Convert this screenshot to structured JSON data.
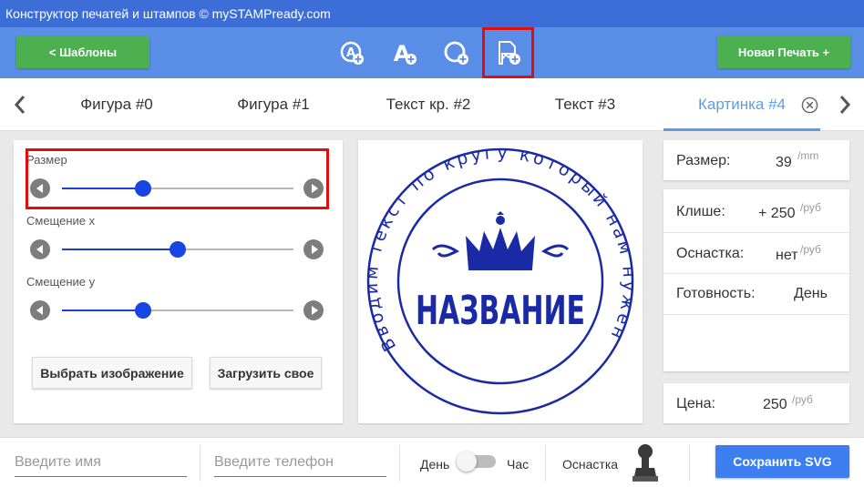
{
  "window": {
    "title": "Конструктор печатей и штампов © mySTAMPready.com"
  },
  "toolbar": {
    "templates_label": "<  Шаблоны",
    "new_stamp_label": "Новая Печать +",
    "tools": [
      "add-circle-text-icon",
      "add-text-icon",
      "add-shape-icon",
      "add-image-icon"
    ],
    "highlighted_tool": "add-image-icon"
  },
  "tabs": {
    "items": [
      {
        "label": "Фигура #0"
      },
      {
        "label": "Фигура #1"
      },
      {
        "label": "Текст кр. #2"
      },
      {
        "label": "Текст #3"
      },
      {
        "label": "Картинка #4"
      }
    ],
    "active_index": 4
  },
  "controls": {
    "sliders": [
      {
        "label": "Размер",
        "value_fraction": 0.35
      },
      {
        "label": "Смещение х",
        "value_fraction": 0.5
      },
      {
        "label": "Смещение у",
        "value_fraction": 0.35
      }
    ],
    "choose_image_label": "Выбрать изображение",
    "upload_label": "Загрузить свое"
  },
  "stamp": {
    "ring_text": "Вводим текст по кругу который нам нужен",
    "center_text": "НАЗВАНИЕ",
    "color": "#1a2aa6"
  },
  "info": {
    "size_label": "Размер:",
    "size_value": "39",
    "size_unit": "/mm",
    "cliche_label": "Клише:",
    "cliche_value": "+ 250",
    "cliche_unit": "/руб",
    "mount_label": "Оснастка:",
    "mount_value": "нет",
    "mount_unit": "/руб",
    "ready_label": "Готовность:",
    "ready_value": "День",
    "price_label": "Цена:",
    "price_value": "250",
    "price_unit": "/руб"
  },
  "bottom": {
    "name_placeholder": "Введите имя",
    "phone_placeholder": "Введите телефон",
    "day_label": "День",
    "hour_label": "Час",
    "mount_label": "Оснастка",
    "save_label": "Сохранить SVG"
  },
  "colors": {
    "titlebar": "#3d6ed8",
    "toolbar": "#5a8de6",
    "green": "#4caf50",
    "accent_blue": "#5a9ee8",
    "highlight_red": "#e10e0e",
    "slider_blue": "#1744e3"
  }
}
